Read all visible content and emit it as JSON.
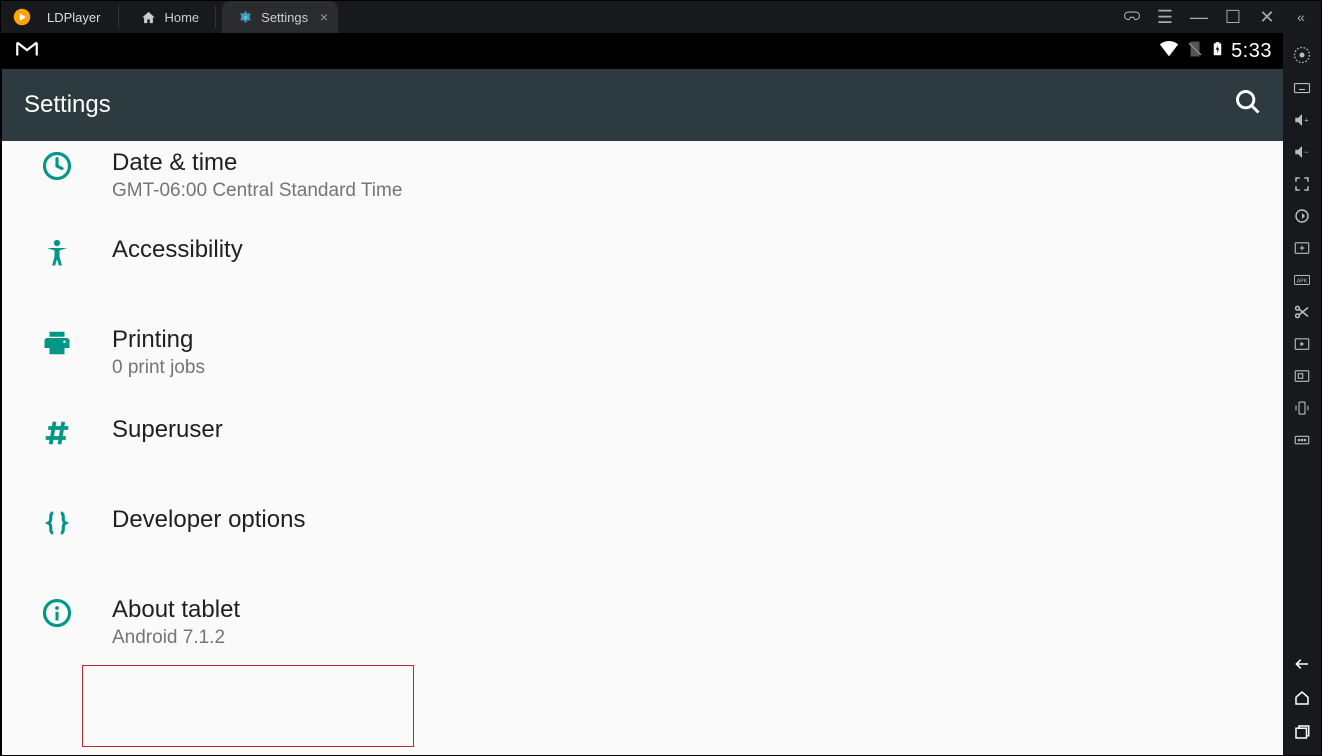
{
  "app": {
    "name": "LDPlayer"
  },
  "tabs": {
    "home": "Home",
    "settings": "Settings"
  },
  "statusbar": {
    "time": "5:33"
  },
  "header": {
    "title": "Settings"
  },
  "items": {
    "datetime": {
      "title": "Date & time",
      "sub": "GMT-06:00 Central Standard Time"
    },
    "accessibility": {
      "title": "Accessibility"
    },
    "printing": {
      "title": "Printing",
      "sub": "0 print jobs"
    },
    "superuser": {
      "title": "Superuser"
    },
    "devopts": {
      "title": "Developer options"
    },
    "about": {
      "title": "About tablet",
      "sub": "Android 7.1.2"
    }
  }
}
